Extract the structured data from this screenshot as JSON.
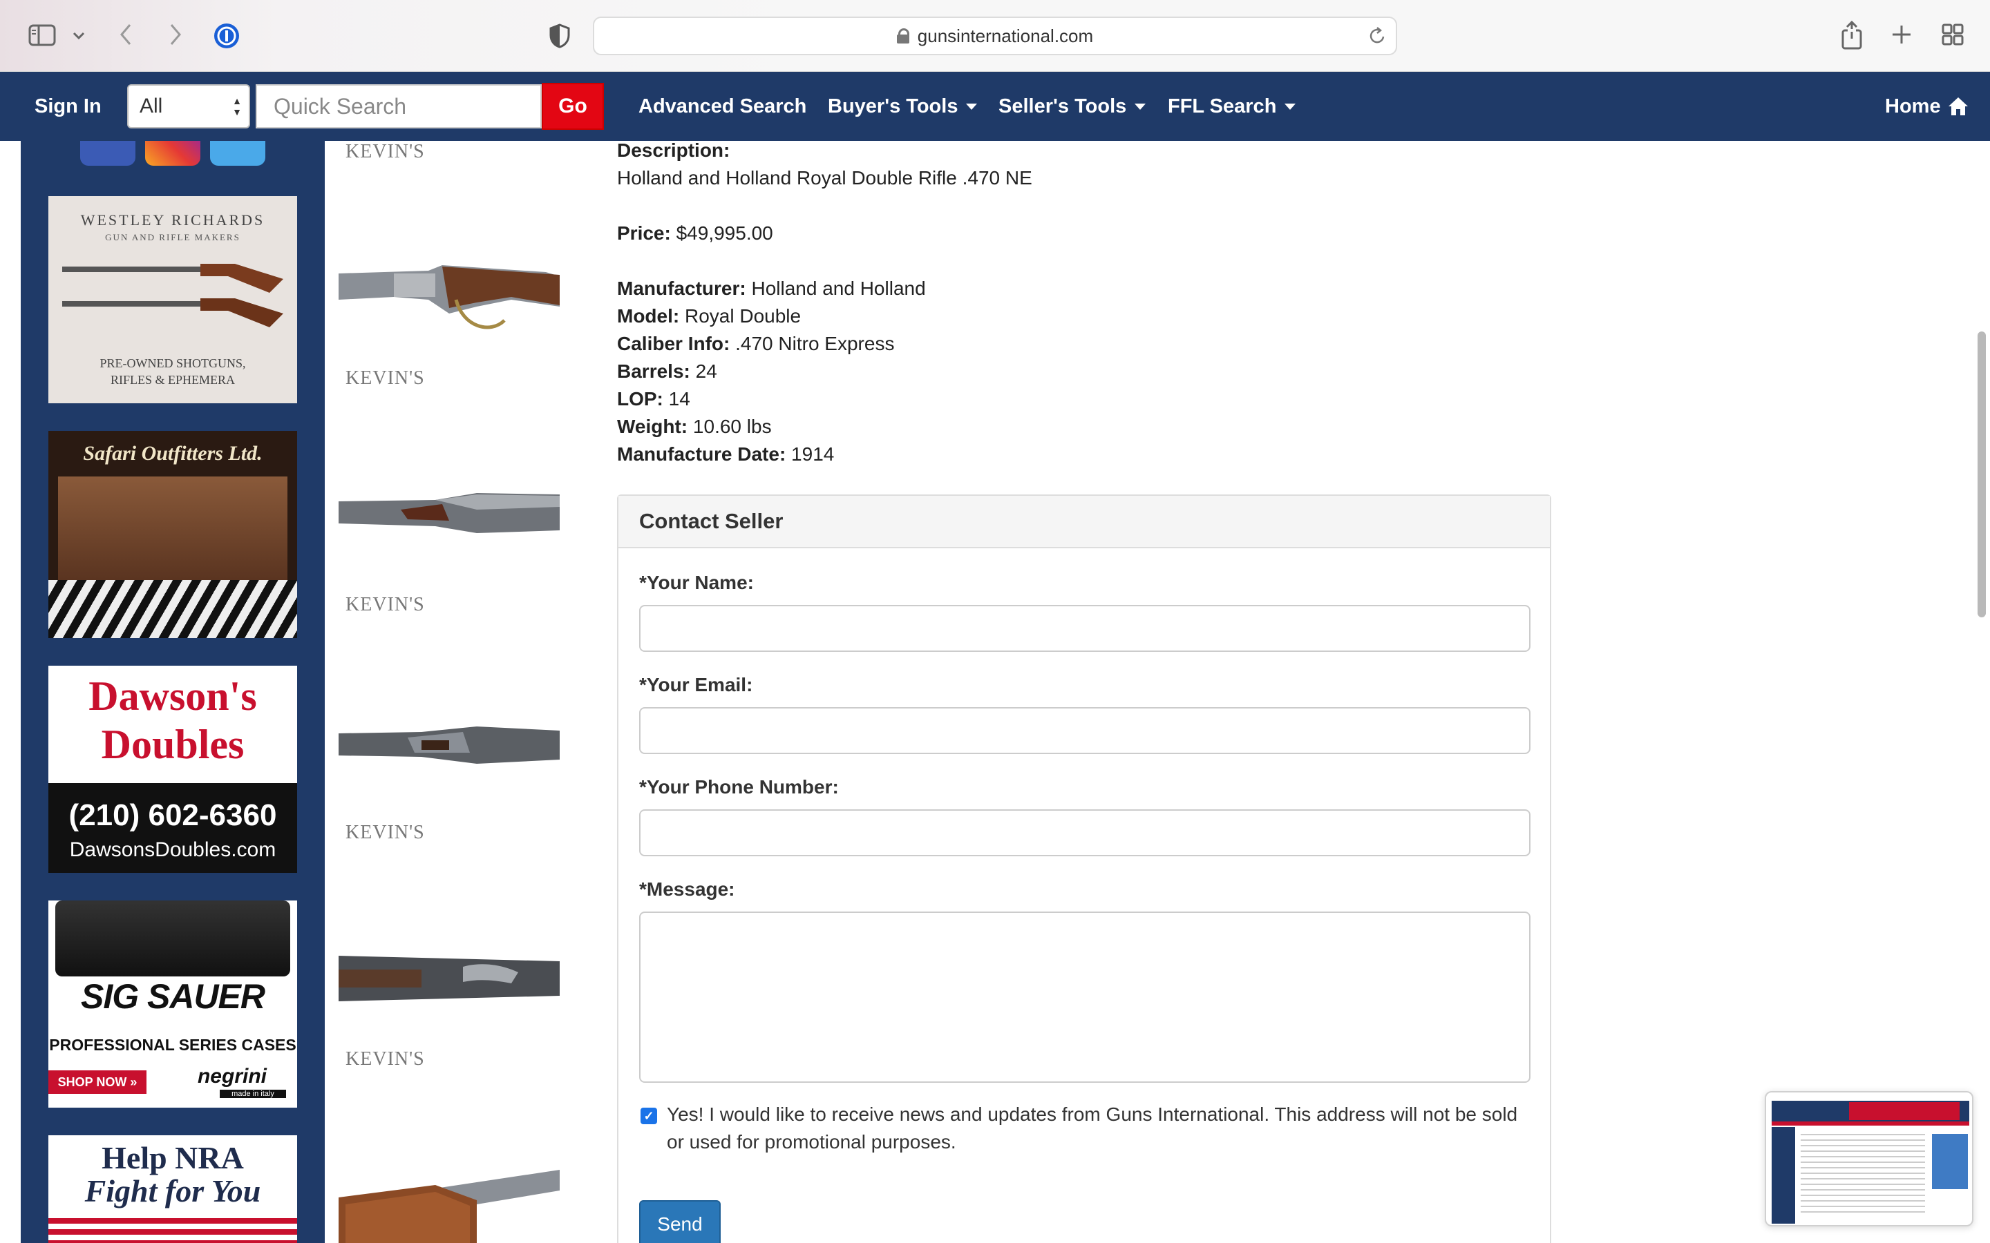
{
  "browser": {
    "url": "gunsinternational.com"
  },
  "nav": {
    "sign_in": "Sign In",
    "category_select": "All",
    "search_placeholder": "Quick Search",
    "go_label": "Go",
    "advanced_search": "Advanced Search",
    "buyers_tools": "Buyer's Tools",
    "sellers_tools": "Seller's Tools",
    "ffl_search": "FFL Search",
    "home": "Home"
  },
  "sidebar_ads": [
    {
      "name": "westley-richards",
      "line1": "WESTLEY RICHARDS",
      "line2": "GUN AND RIFLE MAKERS",
      "line3": "PRE-OWNED SHOTGUNS,",
      "line4": "RIFLES & EPHEMERA"
    },
    {
      "name": "safari-outfitters",
      "line1": "Safari Outfitters Ltd."
    },
    {
      "name": "dawsons-doubles",
      "line1": "Dawson's",
      "line2": "Doubles",
      "line3": "(210) 602-6360",
      "line4": "DawsonsDoubles.com"
    },
    {
      "name": "sig-sauer",
      "line1": "SIG SAUER",
      "line2": "PROFESSIONAL SERIES CASES",
      "line3": "SHOP NOW »",
      "line4": "negrini",
      "line5": "made in italy"
    },
    {
      "name": "nra",
      "line1": "Help NRA",
      "line2": "Fight for You"
    }
  ],
  "thumbnail_watermark": "KEVIN'S",
  "listing": {
    "description_label": "Description:",
    "description": "Holland and Holland Royal Double Rifle .470 NE",
    "price_label": "Price:",
    "price": "$49,995.00",
    "specs": [
      {
        "label": "Manufacturer:",
        "value": "Holland and Holland"
      },
      {
        "label": "Model:",
        "value": "Royal Double"
      },
      {
        "label": "Caliber Info:",
        "value": ".470 Nitro Express"
      },
      {
        "label": "Barrels:",
        "value": "24"
      },
      {
        "label": "LOP:",
        "value": "14"
      },
      {
        "label": "Weight:",
        "value": "10.60 lbs"
      },
      {
        "label": "Manufacture Date:",
        "value": "1914"
      }
    ]
  },
  "contact": {
    "title": "Contact Seller",
    "name_label": "*Your Name:",
    "email_label": "*Your Email:",
    "phone_label": "*Your Phone Number:",
    "message_label": "*Message:",
    "optin_text": "Yes! I would like to receive news and updates from Guns International. This address will not be sold or used for promotional purposes.",
    "optin_checked": true,
    "send_label": "Send"
  },
  "colors": {
    "nav_bg": "#1f3a68",
    "go_button": "#e30613",
    "send_button": "#2a77b8"
  }
}
